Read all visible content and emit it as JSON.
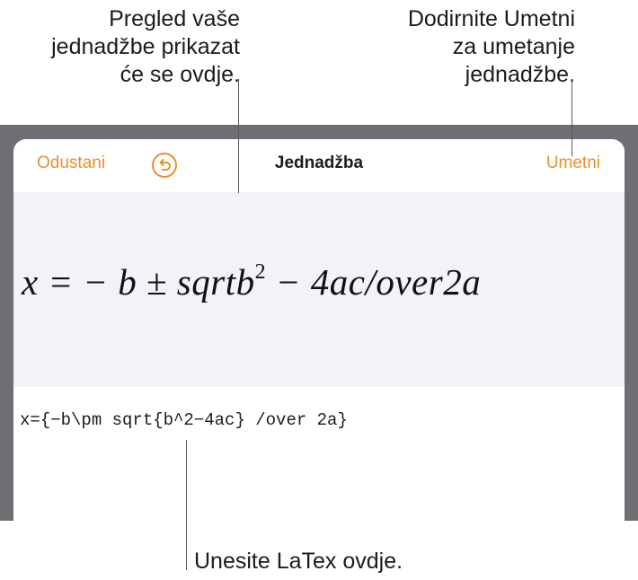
{
  "callouts": {
    "preview": "Pregled vaše\njednadžbe prikazat\nće se ovdje.",
    "insert": "Dodirnite Umetni\nza umetanje\njednadžbe.",
    "latex": "Unesite LaTex ovdje."
  },
  "navbar": {
    "cancel_label": "Odustani",
    "undo_icon": "undo-arrow-icon",
    "title": "Jednadžba",
    "insert_label": "Umetni"
  },
  "preview": {
    "formula_main": "x = − b ± sqrtb",
    "formula_exponent": "2",
    "formula_rest": " − 4ac/over2a"
  },
  "editor": {
    "latex_value": "x={−b\\pm sqrt{b^2−4ac} /over 2a}"
  },
  "colors": {
    "accent": "#e8902a",
    "frame": "#6e6e73",
    "preview_background": "#f2f2f7"
  }
}
